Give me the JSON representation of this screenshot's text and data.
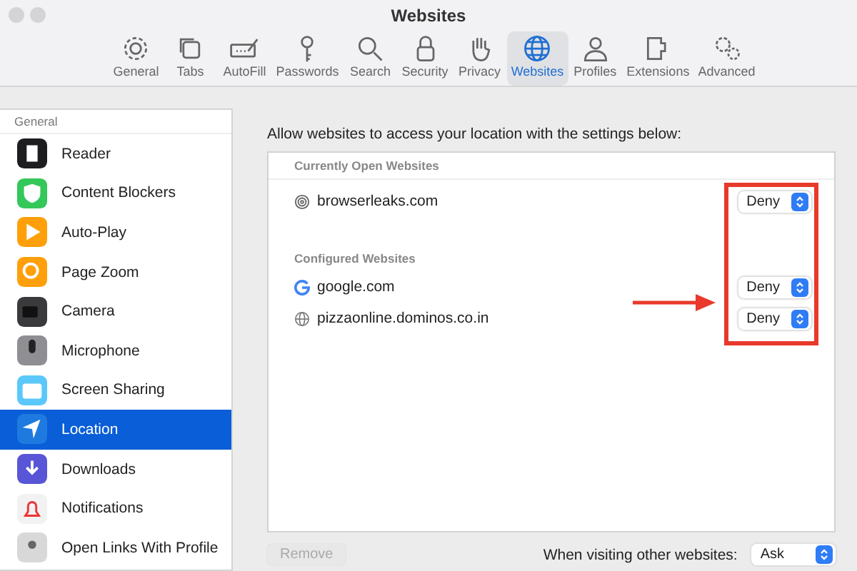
{
  "window": {
    "title": "Websites"
  },
  "toolbar": {
    "items": [
      {
        "label": "General",
        "kind": "gear",
        "selected": false
      },
      {
        "label": "Tabs",
        "kind": "tabs",
        "selected": false
      },
      {
        "label": "AutoFill",
        "kind": "autofill",
        "selected": false
      },
      {
        "label": "Passwords",
        "kind": "key",
        "selected": false
      },
      {
        "label": "Search",
        "kind": "search",
        "selected": false
      },
      {
        "label": "Security",
        "kind": "lock",
        "selected": false
      },
      {
        "label": "Privacy",
        "kind": "hand",
        "selected": false
      },
      {
        "label": "Websites",
        "kind": "globe",
        "selected": true
      },
      {
        "label": "Profiles",
        "kind": "person",
        "selected": false
      },
      {
        "label": "Extensions",
        "kind": "puzzle",
        "selected": false
      },
      {
        "label": "Advanced",
        "kind": "gears",
        "selected": false
      }
    ]
  },
  "sidebar": {
    "section": "General",
    "items": [
      {
        "label": "Reader",
        "kind": "reader",
        "selected": false
      },
      {
        "label": "Content Blockers",
        "kind": "shield",
        "selected": false
      },
      {
        "label": "Auto-Play",
        "kind": "play",
        "selected": false
      },
      {
        "label": "Page Zoom",
        "kind": "zoom",
        "selected": false
      },
      {
        "label": "Camera",
        "kind": "camera",
        "selected": false
      },
      {
        "label": "Microphone",
        "kind": "mic",
        "selected": false
      },
      {
        "label": "Screen Sharing",
        "kind": "screen",
        "selected": false
      },
      {
        "label": "Location",
        "kind": "location",
        "selected": true
      },
      {
        "label": "Downloads",
        "kind": "download",
        "selected": false
      },
      {
        "label": "Notifications",
        "kind": "bell",
        "selected": false
      },
      {
        "label": "Open Links With Profile",
        "kind": "profile",
        "selected": false
      }
    ]
  },
  "main": {
    "description": "Allow websites to access your location with the settings below:",
    "sections": [
      {
        "heading": "Currently Open Websites",
        "sites": [
          {
            "name": "browserleaks.com",
            "kind": "fingerprint",
            "setting": "Deny"
          }
        ]
      },
      {
        "heading": "Configured Websites",
        "sites": [
          {
            "name": "google.com",
            "kind": "google",
            "setting": "Deny"
          },
          {
            "name": "pizzaonline.dominos.co.in",
            "kind": "globe",
            "setting": "Deny"
          }
        ]
      }
    ]
  },
  "footer": {
    "remove_button": {
      "label": "Remove",
      "disabled": true
    },
    "other_label": "When visiting other websites:",
    "other_setting": "Ask"
  }
}
